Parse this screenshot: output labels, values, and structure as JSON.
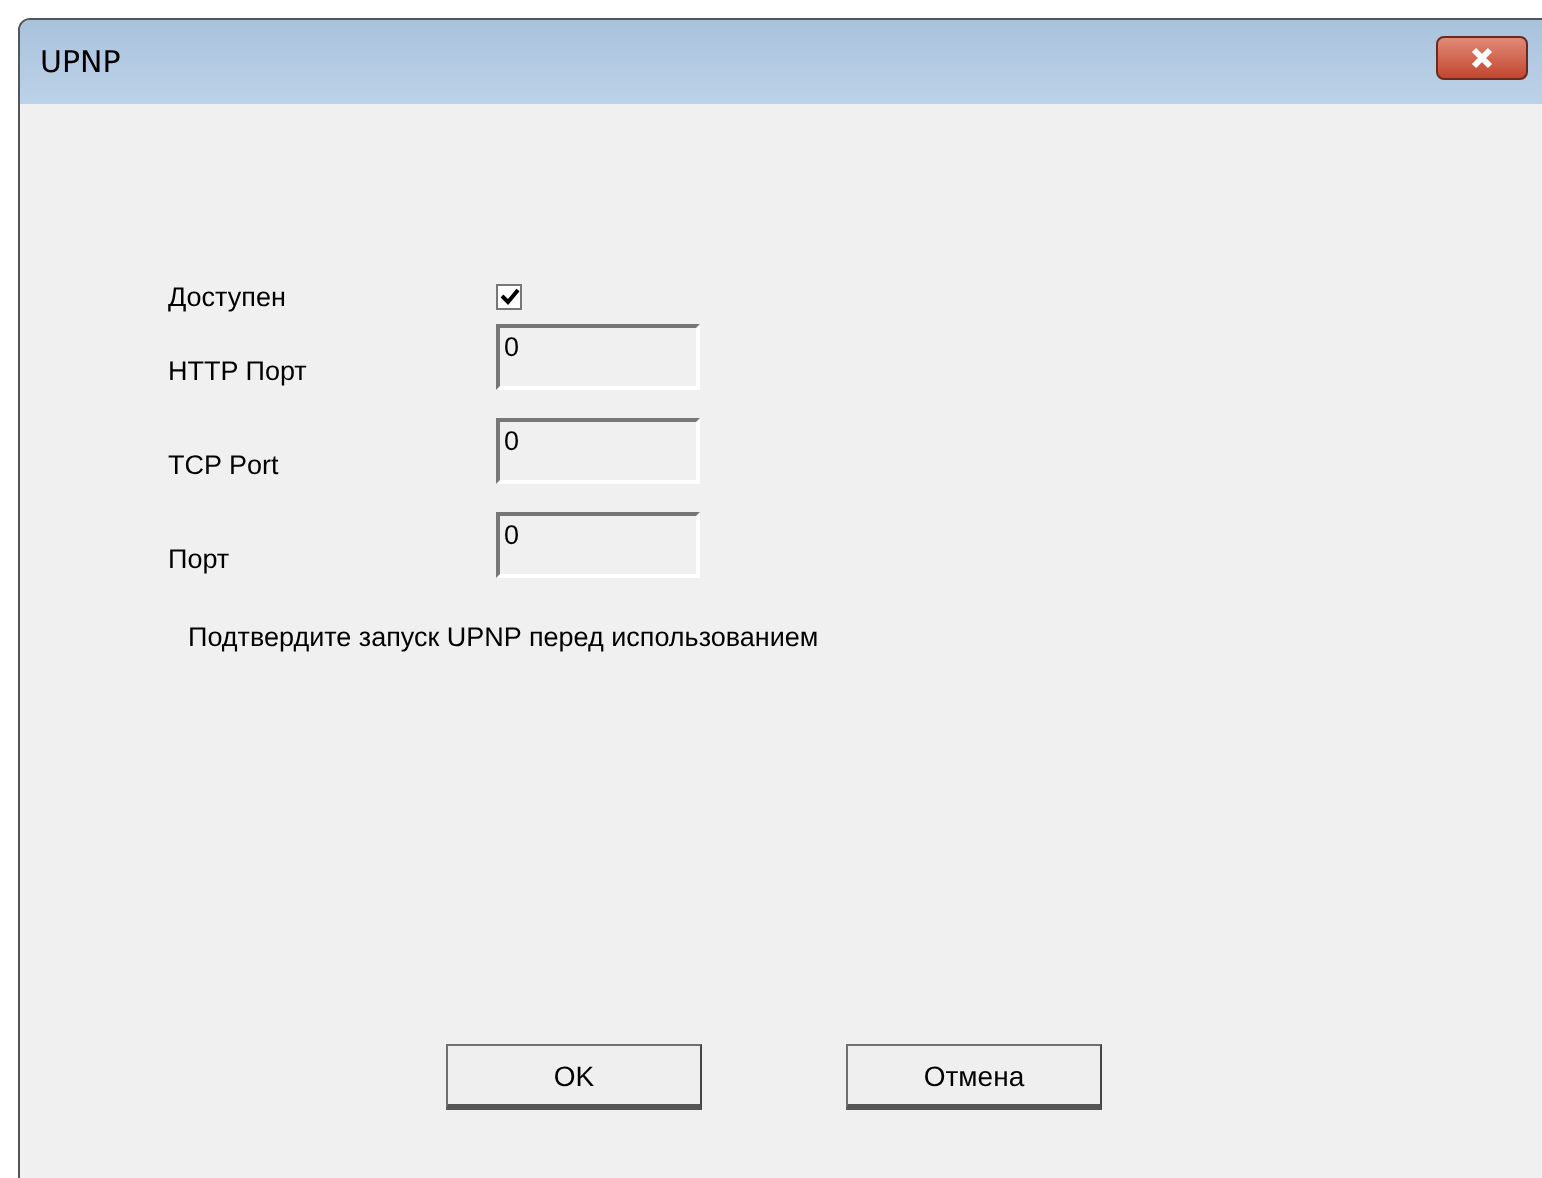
{
  "window": {
    "title": "UPNP"
  },
  "fields": [
    {
      "kind": "checkbox",
      "label": "Доступен",
      "checked": true
    },
    {
      "kind": "text",
      "label": "HTTP Порт",
      "value": "0"
    },
    {
      "kind": "text",
      "label": "TCP Port",
      "value": "0"
    },
    {
      "kind": "text",
      "label": "Порт",
      "value": "0"
    }
  ],
  "note": "Подтвердите запуск UPNP перед использованием",
  "buttons": [
    "OK",
    "Отмена"
  ]
}
